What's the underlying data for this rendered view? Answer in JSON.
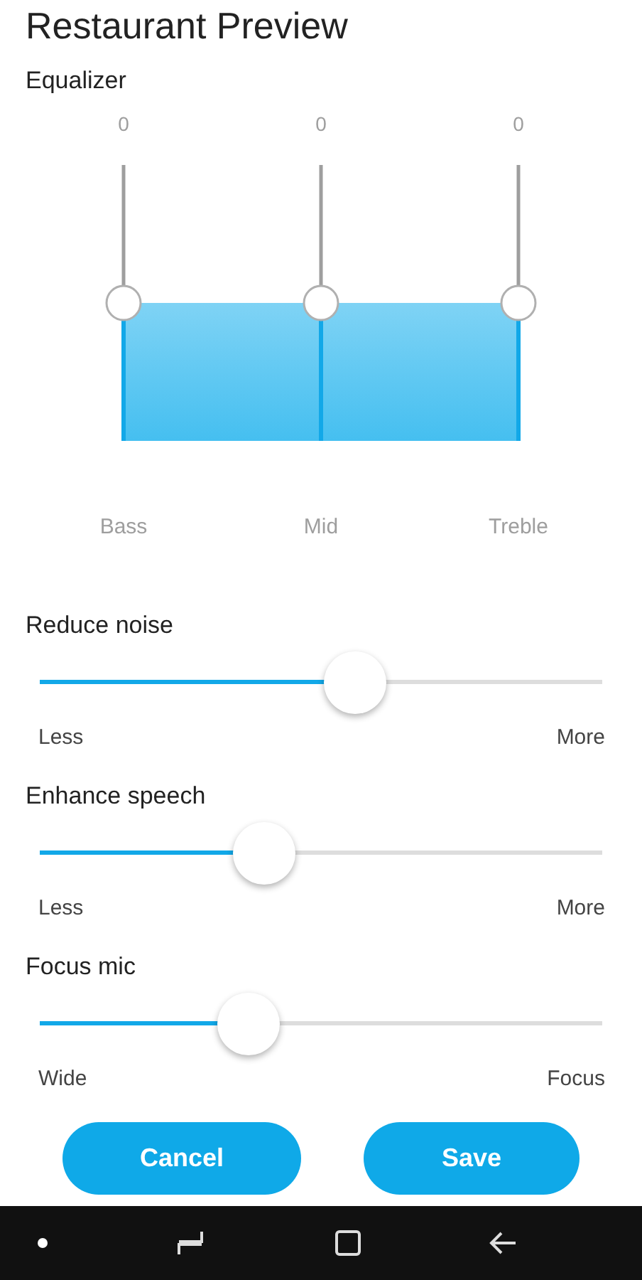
{
  "title": "Restaurant Preview",
  "equalizer": {
    "label": "Equalizer",
    "bands": [
      {
        "value": "0",
        "name": "Bass",
        "level": 0.5
      },
      {
        "value": "0",
        "name": "Mid",
        "level": 0.5
      },
      {
        "value": "0",
        "name": "Treble",
        "level": 0.5
      }
    ]
  },
  "sliders": [
    {
      "label": "Reduce noise",
      "level": 0.56,
      "min_label": "Less",
      "max_label": "More"
    },
    {
      "label": "Enhance speech",
      "level": 0.4,
      "min_label": "Less",
      "max_label": "More"
    },
    {
      "label": "Focus mic",
      "level": 0.37,
      "min_label": "Wide",
      "max_label": "Focus"
    }
  ],
  "buttons": [
    "Cancel",
    "Save"
  ]
}
